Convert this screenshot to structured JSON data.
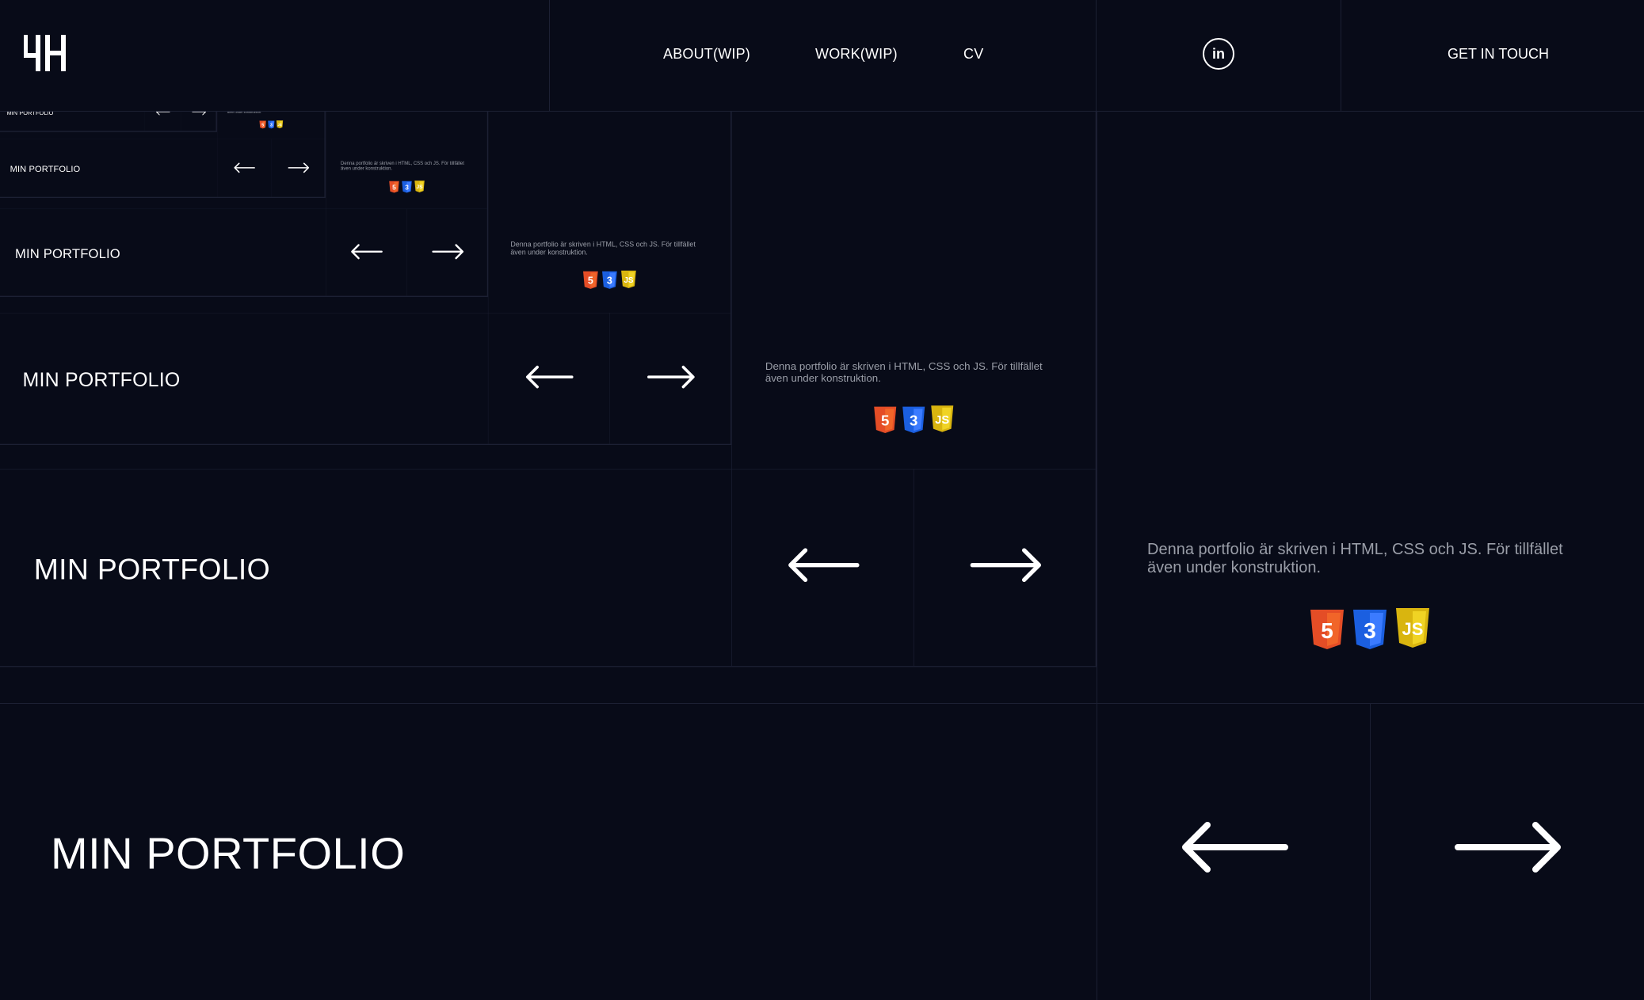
{
  "header": {
    "logo_icon": "monogram-logo-icon",
    "nav": [
      {
        "label": "ABOUT(WIP)"
      },
      {
        "label": "WORK(WIP)"
      },
      {
        "label": "CV"
      }
    ],
    "linkedin_icon": "linkedin-icon",
    "linkedin_glyph": "in",
    "cta": "GET IN TOUCH"
  },
  "hero": {
    "title": "MIN PORTFOLIO",
    "prev_icon": "arrow-left-icon",
    "next_icon": "arrow-right-icon",
    "description": "Denna portfolio är skriven i HTML, CSS och JS. För tillfället även under konstruktion.",
    "tech": [
      {
        "name": "HTML5",
        "glyph": "5",
        "color": "#e44d26",
        "shade": "#f16529"
      },
      {
        "name": "CSS3",
        "glyph": "3",
        "color": "#1b5fe0",
        "shade": "#3b7bff"
      },
      {
        "name": "JavaScript",
        "glyph": "JS",
        "color": "#d9b50f",
        "shade": "#f0d324"
      }
    ]
  },
  "colors": {
    "background": "#080b18",
    "grid_line": "#1c2033",
    "text": "#ffffff",
    "muted_text": "#9a9ea8"
  }
}
